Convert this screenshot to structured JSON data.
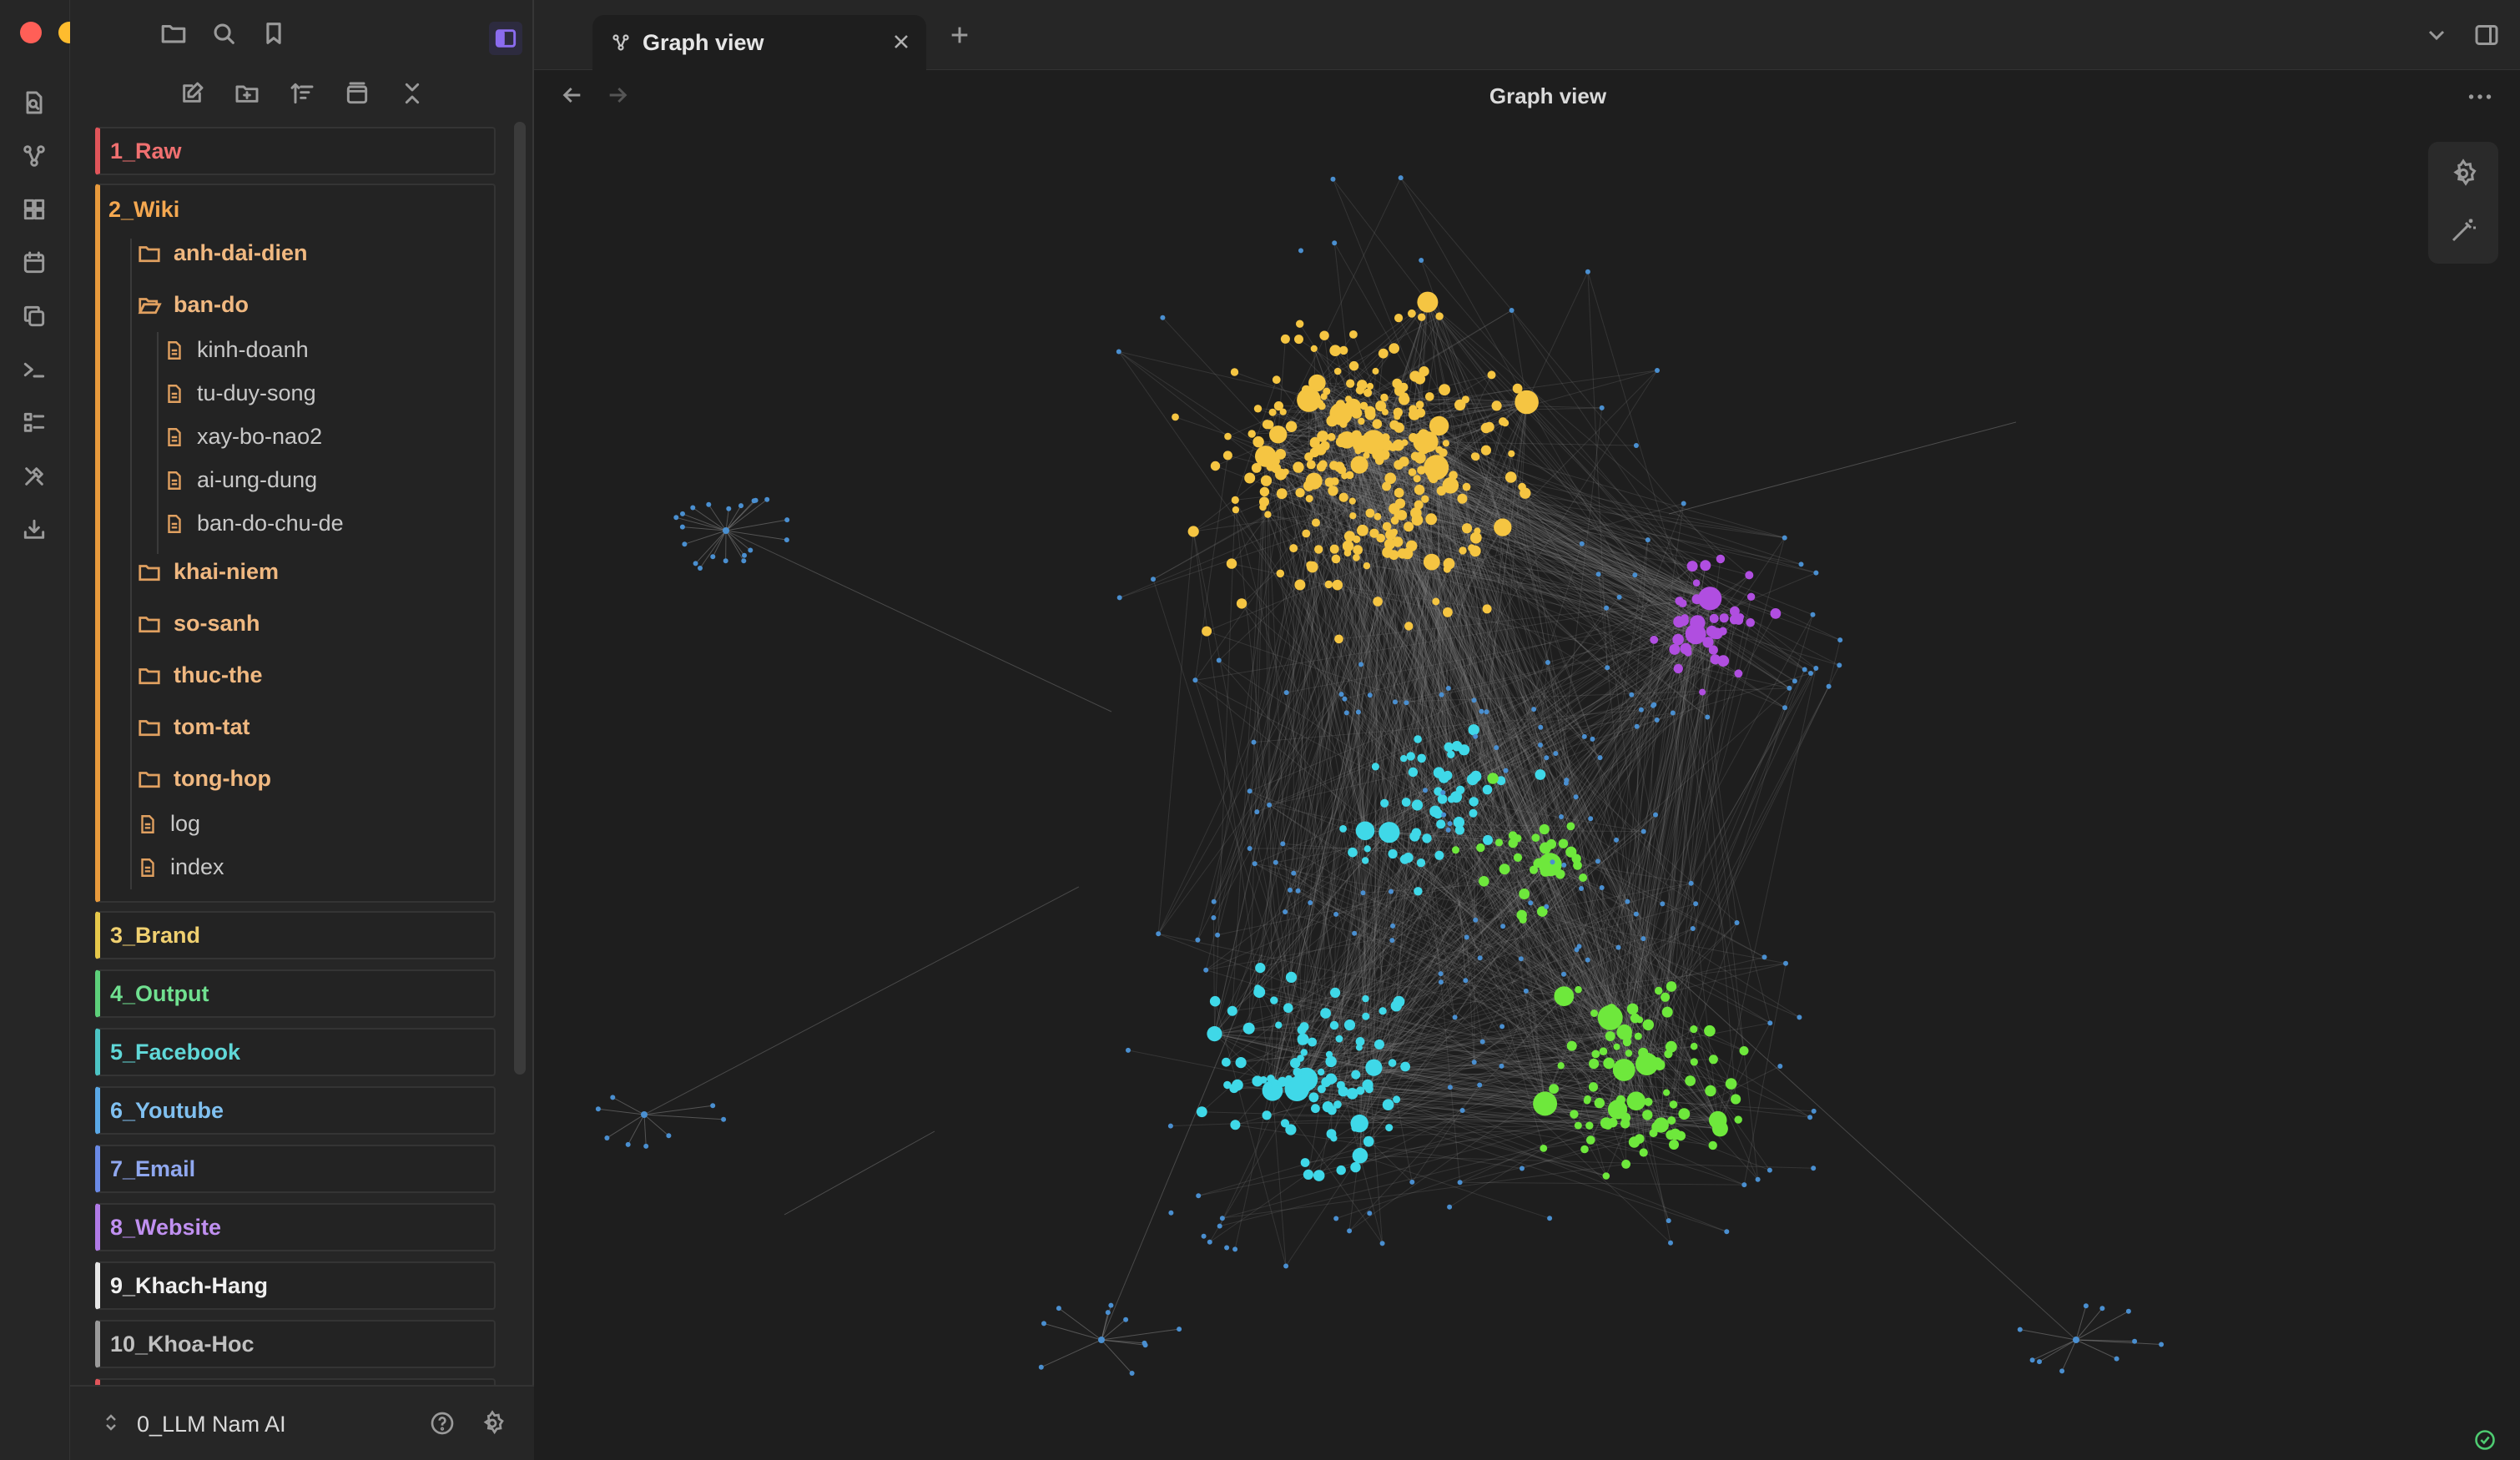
{
  "tab": {
    "title": "Graph view"
  },
  "view_header": {
    "title": "Graph view"
  },
  "explorer": {
    "top_folders": [
      {
        "label": "1_Raw",
        "color": "#e0555a"
      },
      {
        "label": "2_Wiki",
        "color": "#e89a3c"
      },
      {
        "label": "3_Brand",
        "color": "#e6c84a"
      },
      {
        "label": "4_Output",
        "color": "#5dd07a"
      },
      {
        "label": "5_Facebook",
        "color": "#4cc4c4"
      },
      {
        "label": "6_Youtube",
        "color": "#5aa8e6"
      },
      {
        "label": "7_Email",
        "color": "#6a8ae6"
      },
      {
        "label": "8_Website",
        "color": "#b07ae6"
      },
      {
        "label": "9_Khach-Hang",
        "color": "#e6e6e6"
      },
      {
        "label": "10_Khoa-Hoc",
        "color": "#9a9a9a"
      }
    ],
    "wiki_children": {
      "anh_dai_dien": "anh-dai-dien",
      "ban_do": "ban-do",
      "ban_do_files": [
        "kinh-doanh",
        "tu-duy-song",
        "xay-bo-nao2",
        "ai-ung-dung",
        "ban-do-chu-de"
      ],
      "khai_niem": "khai-niem",
      "so_sanh": "so-sanh",
      "thuc_the": "thuc-the",
      "tom_tat": "tom-tat",
      "tong_hop": "tong-hop",
      "log": "log",
      "index": "index"
    }
  },
  "vault": {
    "name": "0_LLM Nam AI"
  },
  "colors": {
    "accent": "#8b6cef",
    "graph_yellow": "#f5c542",
    "graph_purple": "#b04ee0",
    "graph_cyan": "#3fd8e8",
    "graph_green": "#6ee83c",
    "graph_blue": "#4a8fd0",
    "graph_edge": "#8a8a8a"
  },
  "icons": {
    "ribbon": [
      "search-doc-icon",
      "graph-icon",
      "canvas-icon",
      "calendar-icon",
      "copy-icon",
      "terminal-icon",
      "list-icon",
      "tools-icon",
      "import-icon"
    ],
    "header": [
      "folder-icon",
      "search-icon",
      "bookmark-icon",
      "sidebar-toggle-icon"
    ],
    "explorer_toolbar": [
      "new-note-icon",
      "new-folder-icon",
      "sort-icon",
      "collapse-view-icon",
      "collapse-all-icon"
    ]
  }
}
